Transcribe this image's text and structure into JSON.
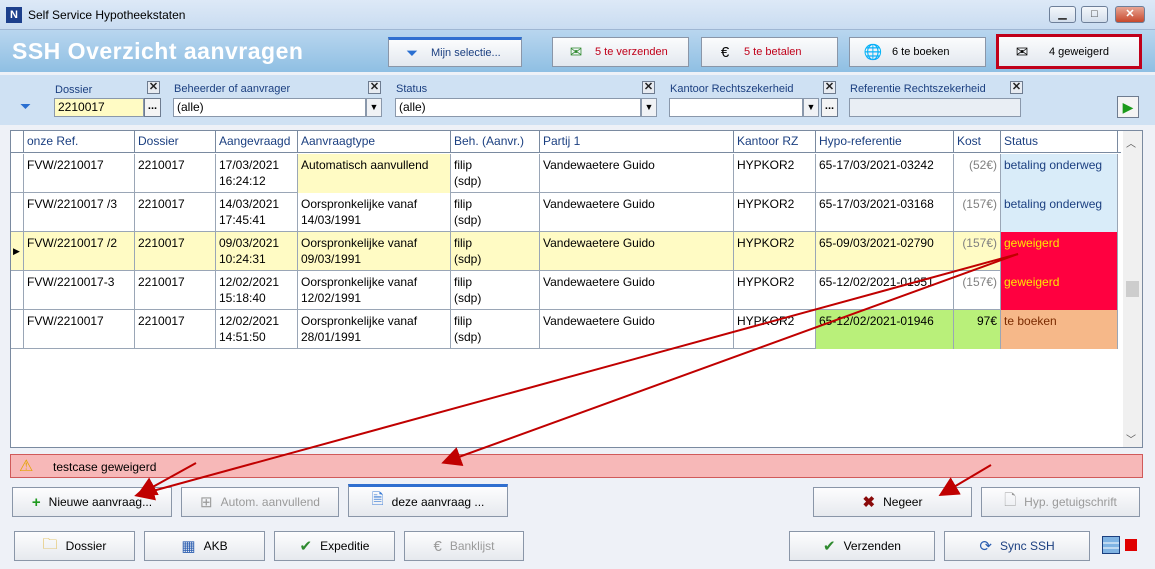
{
  "window": {
    "title": "Self Service Hypotheekstaten"
  },
  "header": {
    "title": "SSH  Overzicht aanvragen",
    "selection_label": "Mijn selectie...",
    "to_send": "5 te verzenden",
    "to_pay": "5 te betalen",
    "to_book": "6 te boeken",
    "refused": "4 geweigerd"
  },
  "filters": {
    "dossier_label": "Dossier",
    "dossier_value": "2210017",
    "beheerder_label": "Beheerder of aanvrager",
    "beheerder_value": "(alle)",
    "status_label": "Status",
    "status_value": "(alle)",
    "kantoor_label": "Kantoor Rechtszekerheid",
    "kantoor_value": "",
    "referentie_label": "Referentie Rechtszekerheid",
    "referentie_value": ""
  },
  "grid": {
    "columns": [
      "onze Ref.",
      "Dossier",
      "Aangevraagd",
      "Aanvraagtype",
      "Beh. (Aanvr.)",
      "Partij 1",
      "Kantoor RZ",
      "Hypo-referentie",
      "Kost",
      "Status"
    ],
    "rows": [
      {
        "ref": "FVW/2210017",
        "dossier": "2210017",
        "date": "17/03/2021",
        "time": "16:24:12",
        "type1": "Automatisch aanvullend",
        "type2": "",
        "beh1": "filip",
        "beh2": "(sdp)",
        "partij": "Vandewaetere Guido",
        "kantoor": "HYPKOR2",
        "hypo": "65-17/03/2021-03242",
        "kost": "(52€)",
        "status": "betaling onderweg"
      },
      {
        "ref": "FVW/2210017 /3",
        "dossier": "2210017",
        "date": "14/03/2021",
        "time": "17:45:41",
        "type1": "Oorspronkelijke vanaf",
        "type2": "14/03/1991",
        "beh1": "filip",
        "beh2": "(sdp)",
        "partij": "Vandewaetere Guido",
        "kantoor": "HYPKOR2",
        "hypo": "65-17/03/2021-03168",
        "kost": "(157€)",
        "status": "betaling onderweg"
      },
      {
        "ref": "FVW/2210017 /2",
        "dossier": "2210017",
        "date": "09/03/2021",
        "time": "10:24:31",
        "type1": "Oorspronkelijke vanaf",
        "type2": "09/03/1991",
        "beh1": "filip",
        "beh2": "(sdp)",
        "partij": "Vandewaetere Guido",
        "kantoor": "HYPKOR2",
        "hypo": "65-09/03/2021-02790",
        "kost": "(157€)",
        "status": "geweigerd"
      },
      {
        "ref": "FVW/2210017-3",
        "dossier": "2210017",
        "date": "12/02/2021",
        "time": "15:18:40",
        "type1": "Oorspronkelijke vanaf",
        "type2": "12/02/1991",
        "beh1": "filip",
        "beh2": "(sdp)",
        "partij": "Vandewaetere Guido",
        "kantoor": "HYPKOR2",
        "hypo": "65-12/02/2021-01951",
        "kost": "(157€)",
        "status": "geweigerd"
      },
      {
        "ref": "FVW/2210017",
        "dossier": "2210017",
        "date": "12/02/2021",
        "time": "14:51:50",
        "type1": "Oorspronkelijke vanaf",
        "type2": "28/01/1991",
        "beh1": "filip",
        "beh2": "(sdp)",
        "partij": "Vandewaetere Guido",
        "kantoor": "HYPKOR2",
        "hypo": "65-12/02/2021-01946",
        "kost": "97€",
        "status": "te boeken"
      }
    ]
  },
  "message": {
    "text": "testcase geweigerd"
  },
  "actions": {
    "new": "Nieuwe aanvraag...",
    "auto": "Autom. aanvullend",
    "this": "deze aanvraag ...",
    "ignore": "Negeer",
    "certificate": "Hyp. getuigschrift"
  },
  "footer": {
    "dossier": "Dossier",
    "akb": "AKB",
    "expeditie": "Expeditie",
    "banklijst": "Banklijst",
    "verzenden": "Verzenden",
    "sync": "Sync SSH"
  },
  "colors": {
    "selected_row": "#fffbc4",
    "refused": "#ff0040",
    "paying": "#d9ecf9",
    "to_book_status": "#f6b889",
    "to_book_hypo": "#b9f07a",
    "auto_type": "#fffbc4"
  }
}
